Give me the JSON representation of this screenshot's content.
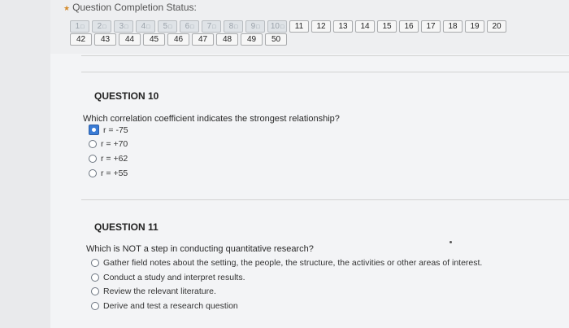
{
  "status": {
    "title": "Question Completion Status:",
    "row1": [
      {
        "label": "1",
        "done": true
      },
      {
        "label": "2",
        "done": true
      },
      {
        "label": "3",
        "done": true
      },
      {
        "label": "4",
        "done": true
      },
      {
        "label": "5",
        "done": true
      },
      {
        "label": "6",
        "done": true
      },
      {
        "label": "7",
        "done": true
      },
      {
        "label": "8",
        "done": true
      },
      {
        "label": "9",
        "done": true
      },
      {
        "label": "10",
        "done": true
      },
      {
        "label": "11",
        "done": false
      },
      {
        "label": "12",
        "done": false
      },
      {
        "label": "13",
        "done": false
      },
      {
        "label": "14",
        "done": false
      },
      {
        "label": "15",
        "done": false
      },
      {
        "label": "16",
        "done": false
      },
      {
        "label": "17",
        "done": false
      },
      {
        "label": "18",
        "done": false
      },
      {
        "label": "19",
        "done": false
      },
      {
        "label": "20",
        "done": false
      }
    ],
    "row2": [
      {
        "label": "42",
        "done": false
      },
      {
        "label": "43",
        "done": false
      },
      {
        "label": "44",
        "done": false
      },
      {
        "label": "45",
        "done": false
      },
      {
        "label": "46",
        "done": false
      },
      {
        "label": "47",
        "done": false
      },
      {
        "label": "48",
        "done": false
      },
      {
        "label": "49",
        "done": false
      },
      {
        "label": "50",
        "done": false
      }
    ]
  },
  "q10": {
    "title": "QUESTION 10",
    "text": "Which correlation coefficient indicates the strongest relationship?",
    "options": [
      {
        "label": "r = -75",
        "selected": true
      },
      {
        "label": "r = +70",
        "selected": false
      },
      {
        "label": "r = +62",
        "selected": false
      },
      {
        "label": "r = +55",
        "selected": false
      }
    ]
  },
  "q11": {
    "title": "QUESTION 11",
    "text": "Which is NOT a step in conducting quantitative research?",
    "options": [
      {
        "label": "Gather field notes about the setting, the people, the structure, the activities or other areas of interest.",
        "selected": false
      },
      {
        "label": "Conduct a study and interpret results.",
        "selected": false
      },
      {
        "label": "Review the relevant literature.",
        "selected": false
      },
      {
        "label": "Derive and test a research question",
        "selected": false
      }
    ]
  }
}
